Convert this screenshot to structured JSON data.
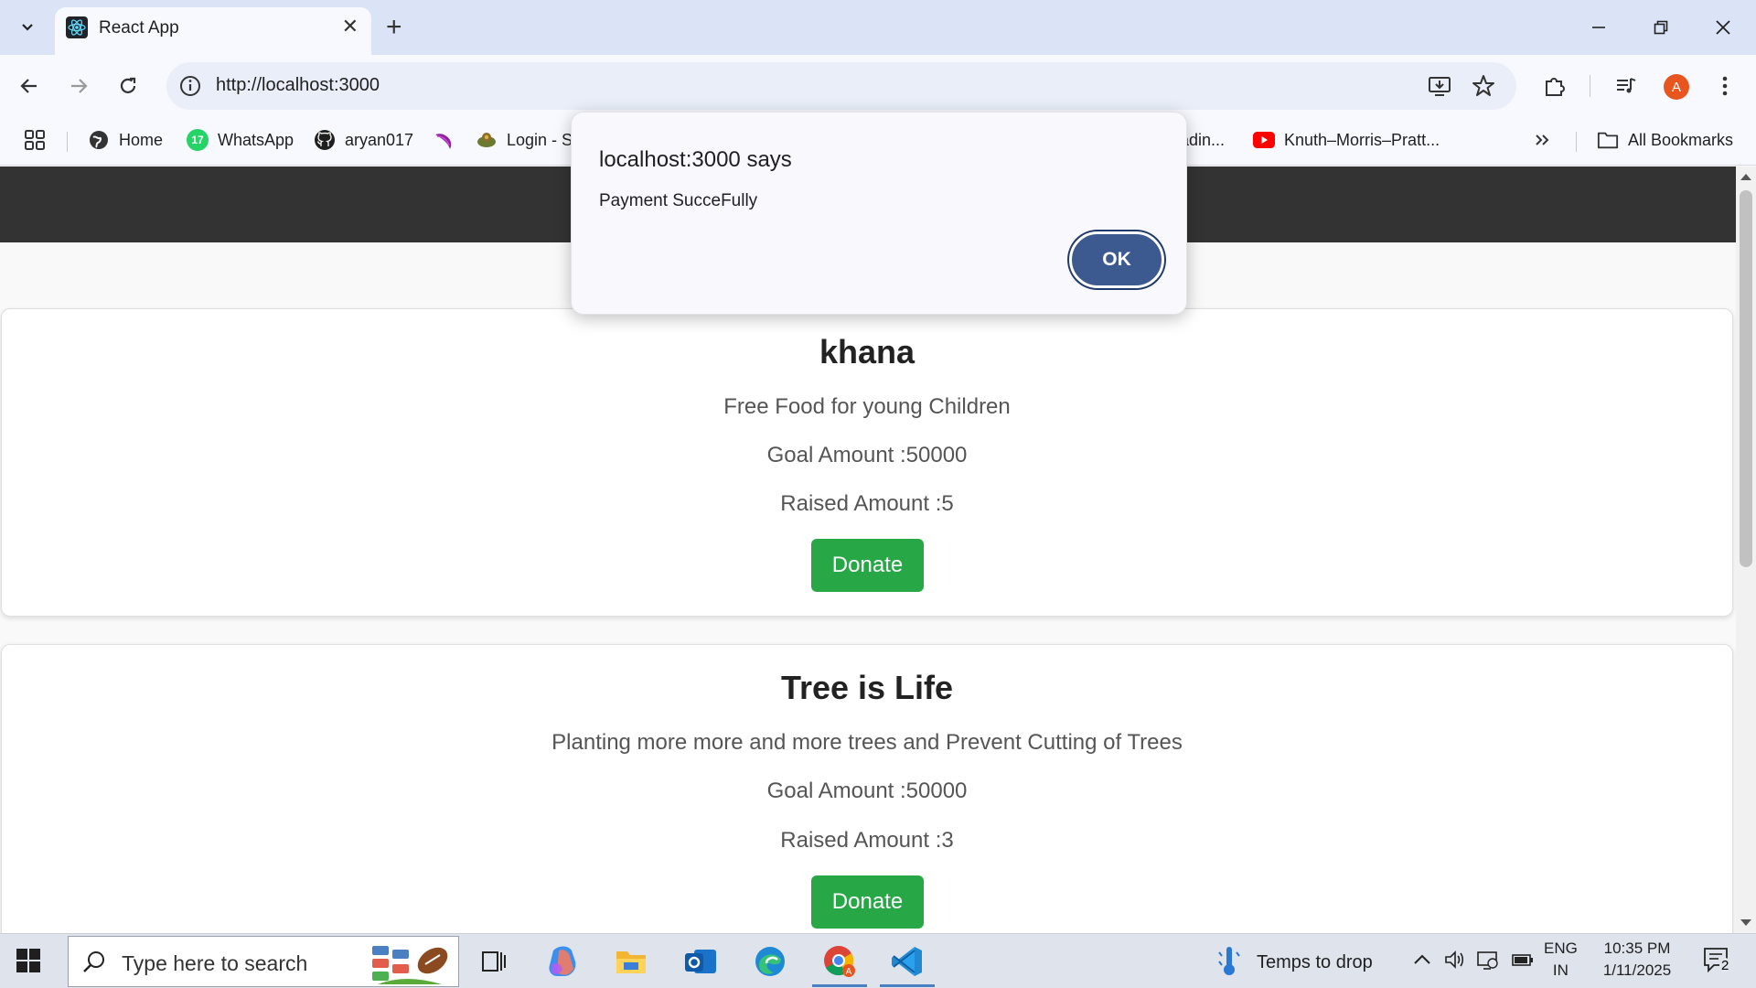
{
  "browser": {
    "tab_title": "React App",
    "url": "http://localhost:3000",
    "bookmarks": [
      "Home",
      "WhatsApp",
      "aryan017",
      "Login - S",
      "adin...",
      "Knuth–Morris–Pratt...",
      "All Bookmarks"
    ],
    "whatsapp_badge": "17",
    "avatar_letter": "A"
  },
  "dialog": {
    "title": "localhost:3000 says",
    "message": "Payment SucceFully",
    "ok_label": "OK"
  },
  "campaigns": [
    {
      "title": "khana",
      "description": "Free Food for young Children",
      "goal": "Goal Amount :50000",
      "raised": "Raised Amount :5",
      "button": "Donate"
    },
    {
      "title": "Tree is Life",
      "description": "Planting more more and more trees and Prevent Cutting of Trees",
      "goal": "Goal Amount :50000",
      "raised": "Raised Amount :3",
      "button": "Donate"
    }
  ],
  "taskbar": {
    "search_placeholder": "Type here to search",
    "weather": "Temps to drop",
    "lang_top": "ENG",
    "lang_bottom": "IN",
    "time": "10:35 PM",
    "date": "1/11/2025",
    "notifications": "2"
  }
}
